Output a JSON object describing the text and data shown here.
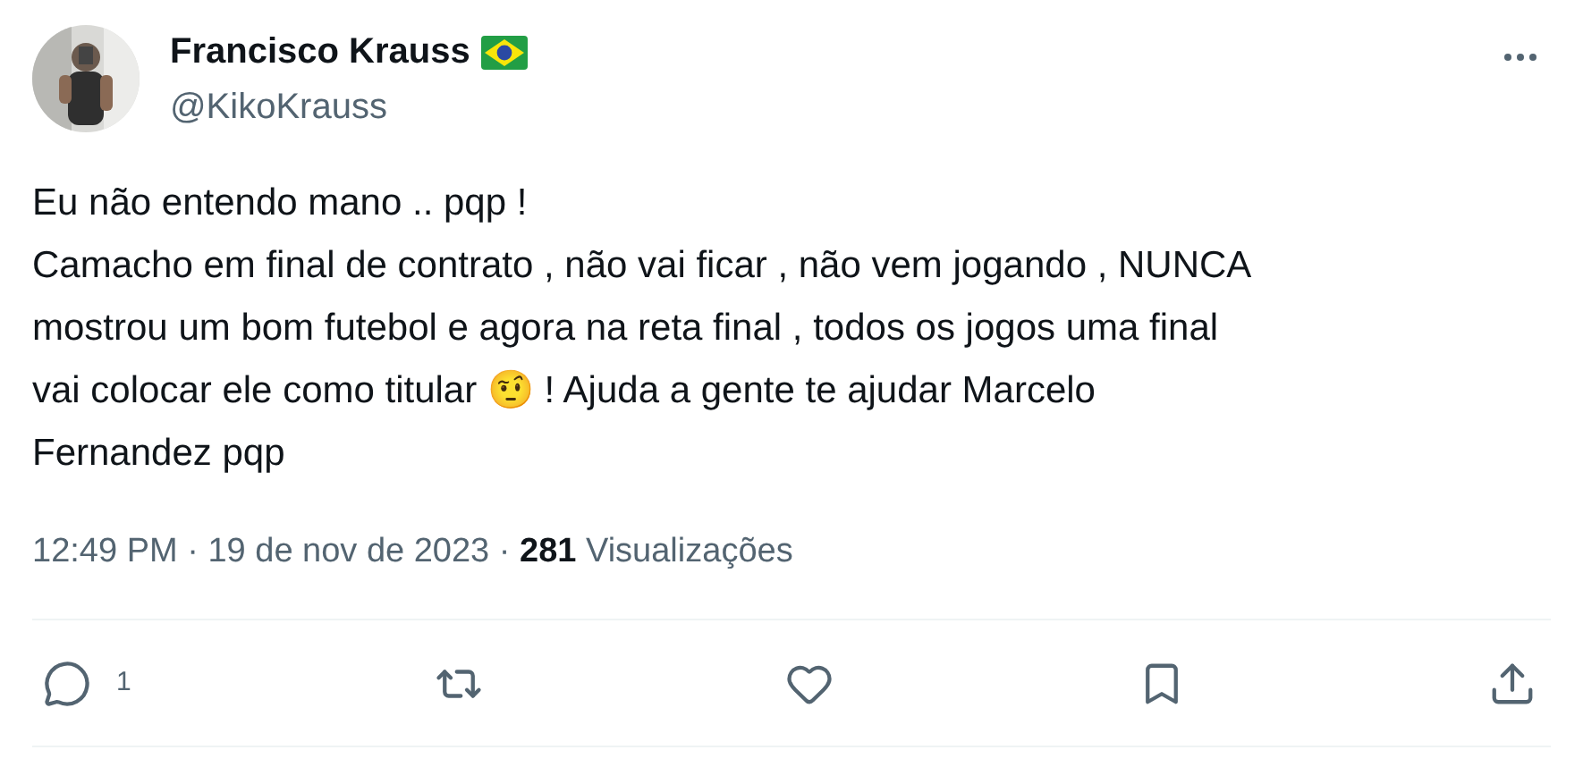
{
  "author": {
    "name": "Francisco Krauss",
    "handle": "@KikoKrauss"
  },
  "tweet": {
    "paragraphs": [
      "Eu não entendo mano .. pqp !",
      "Camacho em final de contrato , não vai ficar , não vem jogando , NUNCA mostrou um bom futebol e agora na reta final , todos os jogos uma final vai colocar ele como titular 🤨 ! Ajuda a gente te ajudar Marcelo Fernandez pqp"
    ]
  },
  "meta": "12:49 PM · 19 de nov de 2023 · **281** Visualizações",
  "actions": [
    {
      "kind": "reply",
      "count": "1"
    },
    {
      "kind": "retweet"
    },
    {
      "kind": "like"
    },
    {
      "kind": "bookmark"
    },
    {
      "kind": "share"
    }
  ]
}
